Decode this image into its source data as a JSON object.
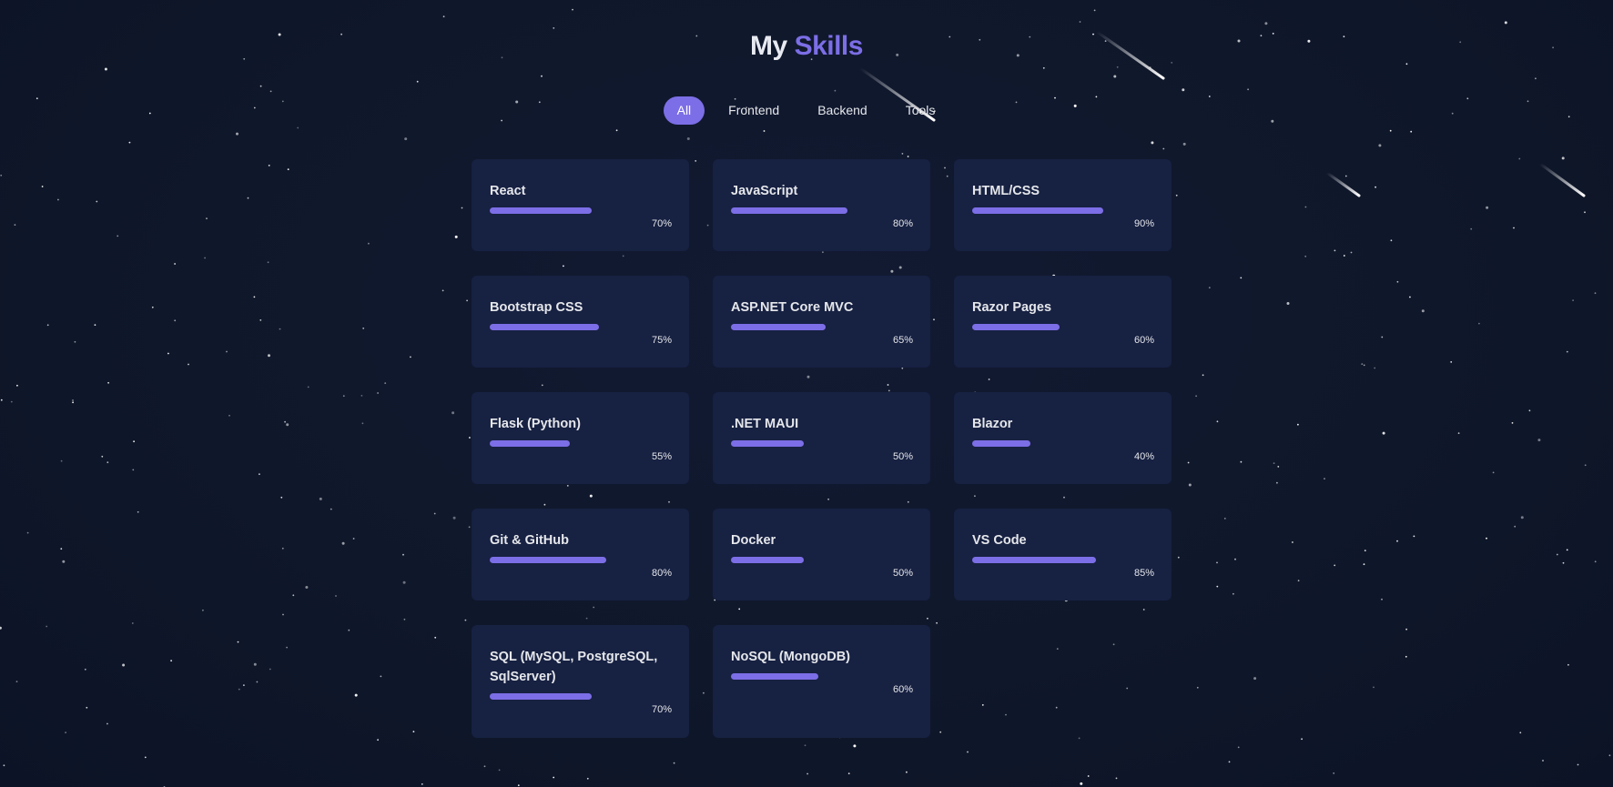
{
  "title": {
    "part1": "My",
    "part2": "Skills"
  },
  "filters": [
    {
      "label": "All",
      "active": true
    },
    {
      "label": "Frontend",
      "active": false
    },
    {
      "label": "Backend",
      "active": false
    },
    {
      "label": "Tools",
      "active": false
    }
  ],
  "skills": [
    {
      "name": "React",
      "level": 70,
      "percent_label": "70%"
    },
    {
      "name": "JavaScript",
      "level": 80,
      "percent_label": "80%"
    },
    {
      "name": "HTML/CSS",
      "level": 90,
      "percent_label": "90%"
    },
    {
      "name": "Bootstrap CSS",
      "level": 75,
      "percent_label": "75%"
    },
    {
      "name": "ASP.NET Core MVC",
      "level": 65,
      "percent_label": "65%"
    },
    {
      "name": "Razor Pages",
      "level": 60,
      "percent_label": "60%"
    },
    {
      "name": "Flask (Python)",
      "level": 55,
      "percent_label": "55%"
    },
    {
      "name": ".NET MAUI",
      "level": 50,
      "percent_label": "50%"
    },
    {
      "name": "Blazor",
      "level": 40,
      "percent_label": "40%"
    },
    {
      "name": "Git & GitHub",
      "level": 80,
      "percent_label": "80%"
    },
    {
      "name": "Docker",
      "level": 50,
      "percent_label": "50%"
    },
    {
      "name": "VS Code",
      "level": 85,
      "percent_label": "85%"
    },
    {
      "name": "SQL (MySQL, PostgreSQL, SqlServer)",
      "level": 70,
      "percent_label": "70%"
    },
    {
      "name": "NoSQL (MongoDB)",
      "level": 60,
      "percent_label": "60%"
    }
  ],
  "colors": {
    "background": "#0f172a",
    "card": "#172142",
    "accent": "#7c6ee6",
    "text": "#e5e7eb"
  }
}
